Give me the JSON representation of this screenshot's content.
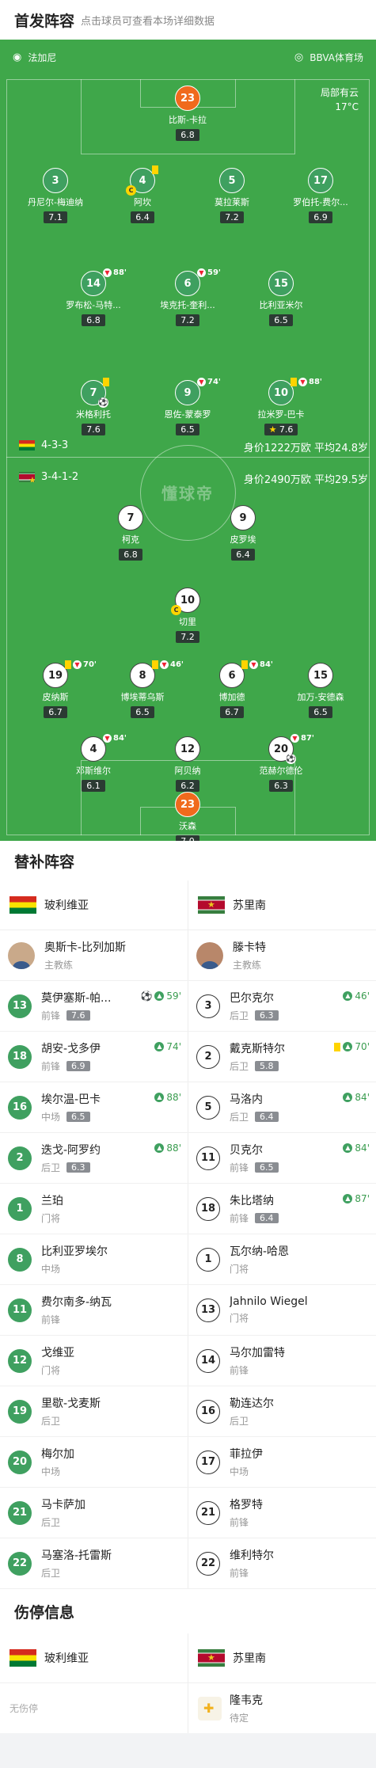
{
  "lineup": {
    "title": "首发阵容",
    "subtitle": "点击球员可查看本场详细数据",
    "referee": "法加尼",
    "venue": "BBVA体育场",
    "weather": "局部有云",
    "temperature": "17°C",
    "watermark": "懂球帝",
    "home_formation": "4-3-3",
    "home_value": "身价1222万欧 平均24.8岁",
    "away_formation": "3-4-1-2",
    "away_value": "身价2490万欧 平均29.5岁",
    "home_players": [
      {
        "num": "23",
        "name": "比斯-卡拉",
        "rating": "6.8",
        "gk": true
      },
      {
        "num": "3",
        "name": "丹尼尔-梅迪纳",
        "rating": "7.1"
      },
      {
        "num": "4",
        "name": "阿坎",
        "rating": "6.4",
        "captain": "C",
        "yellow": true
      },
      {
        "num": "5",
        "name": "莫拉莱斯",
        "rating": "7.2"
      },
      {
        "num": "17",
        "name": "罗伯托-费尔...",
        "rating": "6.9"
      },
      {
        "num": "14",
        "name": "罗布松-马特...",
        "rating": "6.8",
        "sub": "88'"
      },
      {
        "num": "6",
        "name": "埃克托-奎利...",
        "rating": "7.2",
        "sub": "59'"
      },
      {
        "num": "15",
        "name": "比利亚米尔",
        "rating": "6.5"
      },
      {
        "num": "7",
        "name": "米格利托",
        "rating": "7.6",
        "yellow": true,
        "goal": true
      },
      {
        "num": "9",
        "name": "恩佐-蒙泰罗",
        "rating": "6.5",
        "sub": "74'"
      },
      {
        "num": "10",
        "name": "拉米罗-巴卡",
        "rating": "7.6",
        "yellow": true,
        "sub": "88'",
        "star": true
      }
    ],
    "away_players": [
      {
        "num": "7",
        "name": "柯克",
        "rating": "6.8"
      },
      {
        "num": "9",
        "name": "皮罗埃",
        "rating": "6.4"
      },
      {
        "num": "10",
        "name": "切里",
        "rating": "7.2",
        "captain": "C"
      },
      {
        "num": "19",
        "name": "皮纳斯",
        "rating": "6.7",
        "yellow": true,
        "sub": "70'"
      },
      {
        "num": "8",
        "name": "博埃蒂乌斯",
        "rating": "6.5",
        "yellow": true,
        "sub": "46'"
      },
      {
        "num": "6",
        "name": "博加德",
        "rating": "6.7",
        "yellow": true,
        "sub": "84'"
      },
      {
        "num": "15",
        "name": "加万-安德森",
        "rating": "6.5"
      },
      {
        "num": "4",
        "name": "邓斯维尔",
        "rating": "6.1",
        "sub": "84'"
      },
      {
        "num": "12",
        "name": "阿贝纳",
        "rating": "6.2"
      },
      {
        "num": "20",
        "name": "范赫尔德伦",
        "rating": "6.3",
        "sub": "87'",
        "goal": true
      },
      {
        "num": "23",
        "name": "沃森",
        "rating": "7.0",
        "gk": true
      }
    ]
  },
  "subs": {
    "title": "替补阵容",
    "home_team": "玻利维亚",
    "away_team": "苏里南",
    "home_coach": {
      "name": "奥斯卡-比列加斯",
      "role": "主教练"
    },
    "away_coach": {
      "name": "滕卡特",
      "role": "主教练"
    },
    "home": [
      {
        "num": "13",
        "name": "莫伊塞斯-帕...",
        "pos": "前锋",
        "rating": "7.6",
        "event": "59'",
        "goal": true
      },
      {
        "num": "18",
        "name": "胡安-戈多伊",
        "pos": "前锋",
        "rating": "6.9",
        "event": "74'"
      },
      {
        "num": "16",
        "name": "埃尔温-巴卡",
        "pos": "中场",
        "rating": "6.5",
        "event": "88'"
      },
      {
        "num": "2",
        "name": "迭戈-阿罗约",
        "pos": "后卫",
        "rating": "6.3",
        "event": "88'"
      },
      {
        "num": "1",
        "name": "兰珀",
        "pos": "门将"
      },
      {
        "num": "8",
        "name": "比利亚罗埃尔",
        "pos": "中场"
      },
      {
        "num": "11",
        "name": "费尔南多-纳瓦",
        "pos": "前锋"
      },
      {
        "num": "12",
        "name": "戈维亚",
        "pos": "门将"
      },
      {
        "num": "19",
        "name": "里歇-戈麦斯",
        "pos": "后卫"
      },
      {
        "num": "20",
        "name": "梅尔加",
        "pos": "中场"
      },
      {
        "num": "21",
        "name": "马卡萨加",
        "pos": "后卫"
      },
      {
        "num": "22",
        "name": "马塞洛-托雷斯",
        "pos": "后卫"
      }
    ],
    "away": [
      {
        "num": "3",
        "name": "巴尔克尔",
        "pos": "后卫",
        "rating": "6.3",
        "event": "46'"
      },
      {
        "num": "2",
        "name": "戴克斯特尔",
        "pos": "后卫",
        "rating": "5.8",
        "event": "70'",
        "yellow": true
      },
      {
        "num": "5",
        "name": "马洛内",
        "pos": "后卫",
        "rating": "6.4",
        "event": "84'"
      },
      {
        "num": "11",
        "name": "贝克尔",
        "pos": "前锋",
        "rating": "6.5",
        "event": "84'"
      },
      {
        "num": "18",
        "name": "朱比塔纳",
        "pos": "前锋",
        "rating": "6.4",
        "event": "87'"
      },
      {
        "num": "1",
        "name": "瓦尔纳-哈恩",
        "pos": "门将"
      },
      {
        "num": "13",
        "name": "Jahnilo Wiegel",
        "pos": "门将"
      },
      {
        "num": "14",
        "name": "马尔加雷特",
        "pos": "前锋"
      },
      {
        "num": "16",
        "name": "勒连达尔",
        "pos": "后卫"
      },
      {
        "num": "17",
        "name": "菲拉伊",
        "pos": "中场"
      },
      {
        "num": "21",
        "name": "格罗特",
        "pos": "前锋"
      },
      {
        "num": "22",
        "name": "维利特尔",
        "pos": "前锋"
      }
    ]
  },
  "injury": {
    "title": "伤停信息",
    "home_team": "玻利维亚",
    "away_team": "苏里南",
    "home_text": "无伤停",
    "away_player": "隆韦克",
    "away_status": "待定"
  }
}
